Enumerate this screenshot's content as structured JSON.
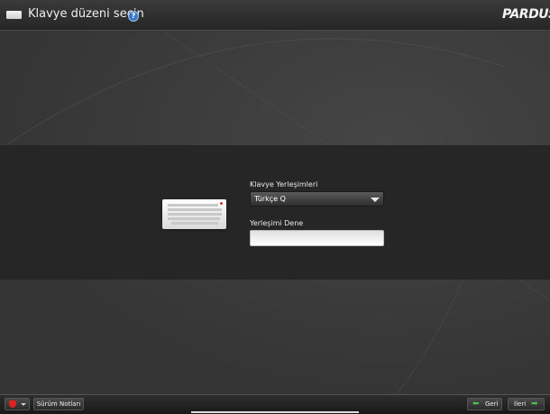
{
  "header": {
    "title": "Klavye düzeni seçin",
    "help_icon": "question-circle-icon",
    "logo_text": "PARDUS"
  },
  "main": {
    "layouts_label": "Klavye Yerleşimleri",
    "layout_selected": "Türkçe Q",
    "test_label": "Yerleşimi Dene",
    "test_value": ""
  },
  "footer": {
    "release_notes": "Sürüm Notları",
    "back_label": "Geri",
    "next_label": "İleri"
  },
  "colors": {
    "accent_green": "#4ec24e",
    "logo_red": "#d22222",
    "help_blue": "#3a78c8"
  }
}
